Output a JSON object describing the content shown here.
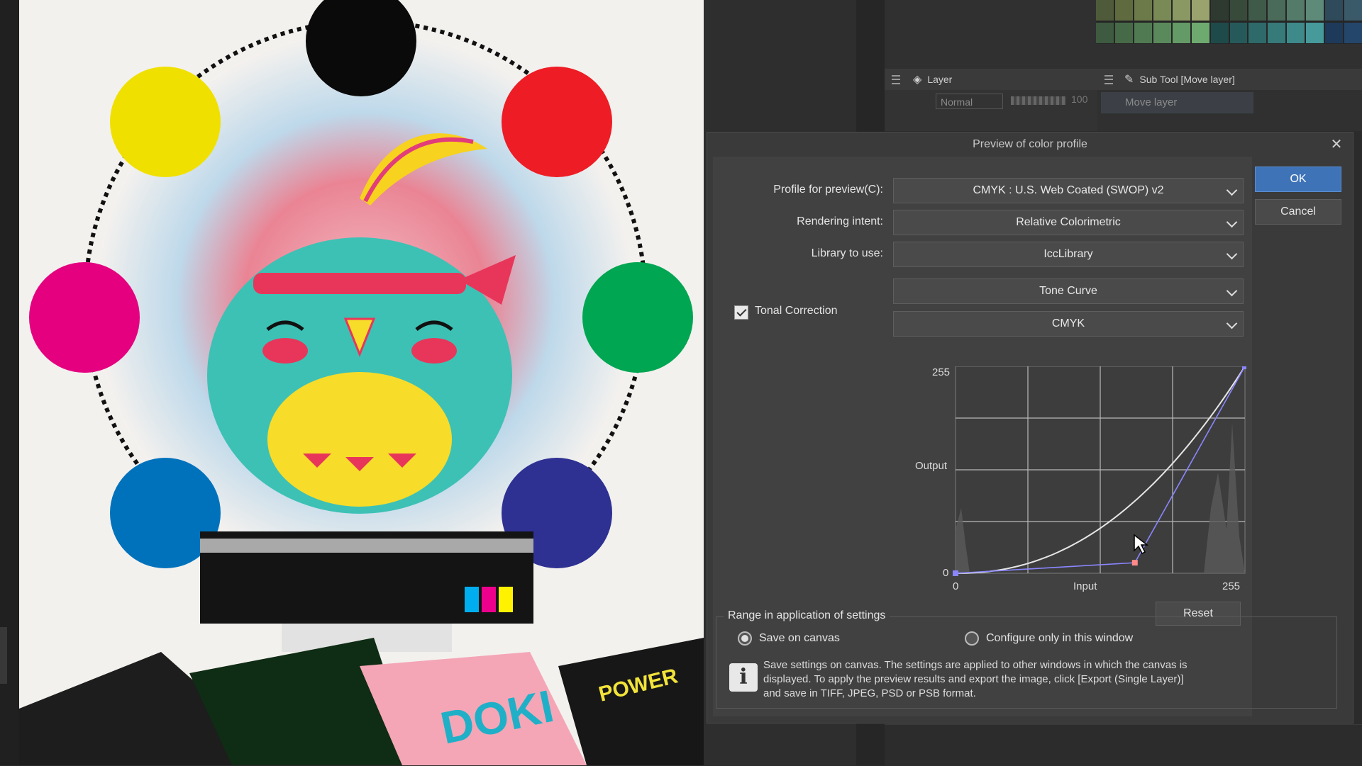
{
  "layer_panel": {
    "tab_label": "Layer",
    "blend_mode": "Normal",
    "opacity": "100"
  },
  "subtool_panel": {
    "tab_label": "Sub Tool [Move layer]",
    "tool_name": "Move layer"
  },
  "dialog": {
    "title": "Preview of color profile",
    "ok_label": "OK",
    "cancel_label": "Cancel",
    "profile_label": "Profile for preview(C):",
    "profile_value": "CMYK : U.S. Web Coated (SWOP) v2",
    "intent_label": "Rendering intent:",
    "intent_value": "Relative Colorimetric",
    "library_label": "Library to use:",
    "library_value": "IccLibrary",
    "tonal_label": "Tonal Correction",
    "tonal_checked": true,
    "correction_type": "Tone Curve",
    "channel": "CMYK",
    "curve": {
      "y_max_label": "255",
      "y_min_label": "0",
      "y_axis_label": "Output",
      "x_min_label": "0",
      "x_max_label": "255",
      "x_axis_label": "Input",
      "control_points": [
        [
          0,
          0
        ],
        [
          158,
          13
        ],
        [
          255,
          255
        ]
      ],
      "preview_curve_color": "#e6e6e6",
      "line_color": "#8a86ff"
    },
    "reset_label": "Reset",
    "range_group_title": "Range in application of settings",
    "option_save_canvas": "Save on canvas",
    "option_window_only": "Configure only in this window",
    "selected_option": "save_canvas",
    "info_text": "Save settings on canvas. The settings are applied to other windows in which the canvas is displayed. To apply the preview results and export the image, click [Export (Single Layer)] and save in TIFF, JPEG, PSD or PSB format."
  },
  "artwork": {
    "color_dots": [
      "#0a0a0a",
      "#f0e000",
      "#ee1c24",
      "#e4007f",
      "#00a651",
      "#0072bc",
      "#2e3192"
    ],
    "ink_colors": [
      "#00aeef",
      "#ec008c",
      "#fff200"
    ],
    "magazine_text_1": "DOKI",
    "magazine_text_2": "POWER"
  }
}
